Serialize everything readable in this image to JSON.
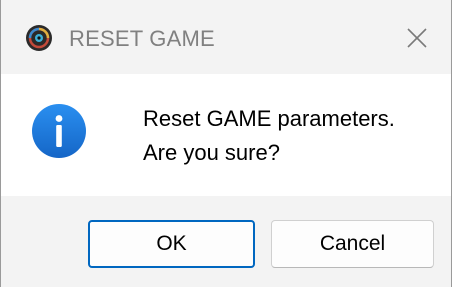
{
  "window": {
    "title": "RESET GAME",
    "app_icon": "game-app-icon",
    "close_icon": "close-icon"
  },
  "message": {
    "icon": "info-icon",
    "line1": "Reset GAME parameters.",
    "line2": "Are you sure?"
  },
  "buttons": {
    "ok_label": "OK",
    "cancel_label": "Cancel"
  },
  "colors": {
    "info_blue": "#1a73d9",
    "default_button_border": "#0067c0"
  }
}
